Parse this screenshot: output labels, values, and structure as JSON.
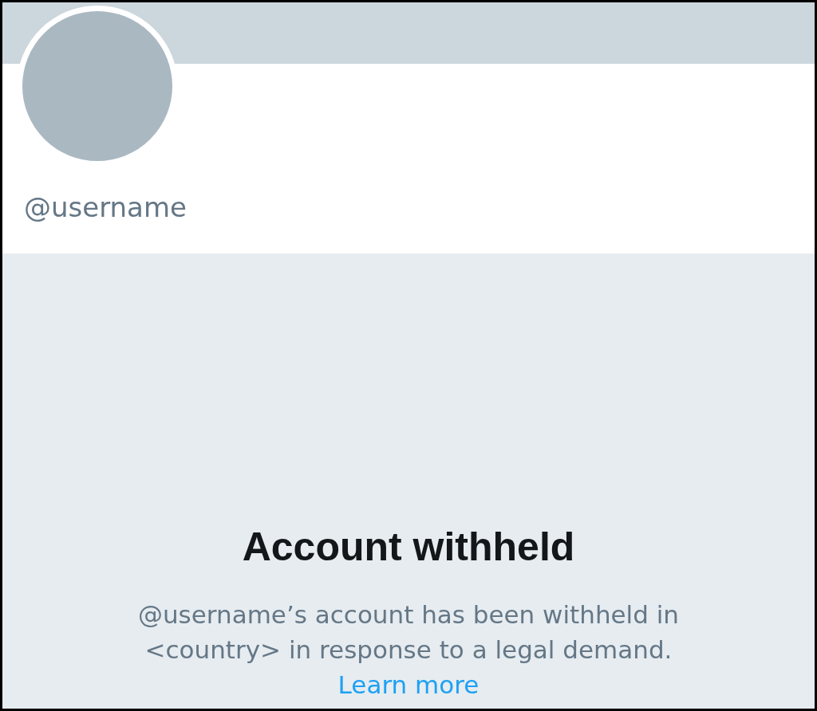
{
  "profile": {
    "username": "@username"
  },
  "notice": {
    "title": "Account withheld",
    "message": "@username’s account has been withheld in <country> in response to a legal demand.",
    "link": "Learn more"
  }
}
